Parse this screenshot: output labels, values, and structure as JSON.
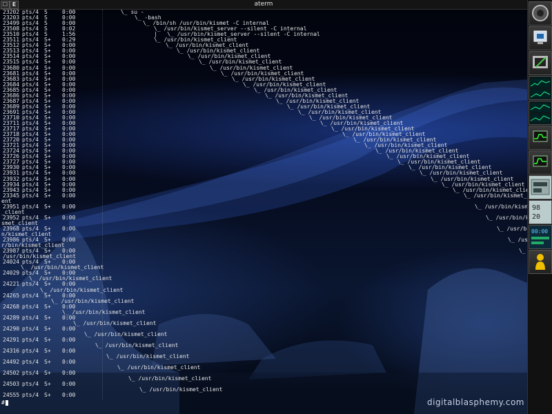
{
  "window": {
    "title": "aterm",
    "left_button": "☐",
    "right_button": "E"
  },
  "process_rows": [
    {
      "pid": "23202",
      "tty": "pts/4",
      "stat": "S",
      "time": "0:00",
      "cmd": "\\_ su -",
      "indent": 175
    },
    {
      "pid": "23203",
      "tty": "pts/4",
      "stat": "S",
      "time": "0:00",
      "cmd": "\\_ -bash",
      "indent": 195
    },
    {
      "pid": "23499",
      "tty": "pts/4",
      "stat": "S",
      "time": "0:00",
      "cmd": "\\_ /bin/sh /usr/bin/kismet -C internal",
      "indent": 207
    },
    {
      "pid": "23508",
      "tty": "pts/4",
      "stat": "S",
      "time": "0:02",
      "cmd": "\\_ /usr/bin/kismet_server --silent -C internal",
      "indent": 223
    },
    {
      "pid": "23510",
      "tty": "pts/4",
      "stat": "S",
      "time": "1:56",
      "cmd": "|   \\_ /usr/bin/kismet_server --silent -C internal",
      "indent": 223
    },
    {
      "pid": "23511",
      "tty": "pts/4",
      "stat": "S+",
      "time": "0:29",
      "cmd": "\\_ /usr/bin/kismet_client",
      "indent": 223
    },
    {
      "pid": "23512",
      "tty": "pts/4",
      "stat": "S+",
      "time": "0:00",
      "cmd": "\\_ /usr/bin/kismet_client",
      "indent": 240
    },
    {
      "pid": "23513",
      "tty": "pts/4",
      "stat": "S+",
      "time": "0:00",
      "cmd": "\\_ /usr/bin/kismet_client",
      "indent": 256
    },
    {
      "pid": "23514",
      "tty": "pts/4",
      "stat": "S+",
      "time": "0:00",
      "cmd": "\\_ /usr/bin/kismet_client",
      "indent": 272
    },
    {
      "pid": "23515",
      "tty": "pts/4",
      "stat": "S+",
      "time": "0:00",
      "cmd": "\\_ /usr/bin/kismet_client",
      "indent": 288
    },
    {
      "pid": "23680",
      "tty": "pts/4",
      "stat": "S+",
      "time": "0:00",
      "cmd": "\\_ /usr/bin/kismet_client",
      "indent": 304
    },
    {
      "pid": "23681",
      "tty": "pts/4",
      "stat": "S+",
      "time": "0:00",
      "cmd": "\\_ /usr/bin/kismet_client",
      "indent": 320
    },
    {
      "pid": "23683",
      "tty": "pts/4",
      "stat": "S+",
      "time": "0:00",
      "cmd": "\\_ /usr/bin/kismet_client",
      "indent": 336
    },
    {
      "pid": "23684",
      "tty": "pts/4",
      "stat": "S+",
      "time": "0:00",
      "cmd": "\\_ /usr/bin/kismet_client",
      "indent": 352
    },
    {
      "pid": "23685",
      "tty": "pts/4",
      "stat": "S+",
      "time": "0:00",
      "cmd": "\\_ /usr/bin/kismet_client",
      "indent": 368
    },
    {
      "pid": "23686",
      "tty": "pts/4",
      "stat": "S+",
      "time": "0:00",
      "cmd": "\\_ /usr/bin/kismet_client",
      "indent": 384
    },
    {
      "pid": "23687",
      "tty": "pts/4",
      "stat": "S+",
      "time": "0:00",
      "cmd": "\\_ /usr/bin/kismet_client",
      "indent": 400
    },
    {
      "pid": "23689",
      "tty": "pts/4",
      "stat": "S+",
      "time": "0:00",
      "cmd": "\\_ /usr/bin/kismet_client",
      "indent": 416
    },
    {
      "pid": "23691",
      "tty": "pts/4",
      "stat": "S+",
      "time": "0:00",
      "cmd": "\\_ /usr/bin/kismet_client",
      "indent": 432
    },
    {
      "pid": "23710",
      "tty": "pts/4",
      "stat": "S+",
      "time": "0:00",
      "cmd": "\\_ /usr/bin/kismet_client",
      "indent": 448
    },
    {
      "pid": "23711",
      "tty": "pts/4",
      "stat": "S+",
      "time": "0:00",
      "cmd": "\\_ /usr/bin/kismet_client",
      "indent": 464
    },
    {
      "pid": "23717",
      "tty": "pts/4",
      "stat": "S+",
      "time": "0:00",
      "cmd": "\\_ /usr/bin/kismet_client",
      "indent": 480
    },
    {
      "pid": "23718",
      "tty": "pts/4",
      "stat": "S+",
      "time": "0:00",
      "cmd": "\\_ /usr/bin/kismet_client",
      "indent": 496
    },
    {
      "pid": "23720",
      "tty": "pts/4",
      "stat": "S+",
      "time": "0:00",
      "cmd": "\\_ /usr/bin/kismet_client",
      "indent": 512
    },
    {
      "pid": "23721",
      "tty": "pts/4",
      "stat": "S+",
      "time": "0:00",
      "cmd": "\\_ /usr/bin/kismet_client",
      "indent": 528
    },
    {
      "pid": "23724",
      "tty": "pts/4",
      "stat": "S+",
      "time": "0:00",
      "cmd": "\\_ /usr/bin/kismet_client",
      "indent": 544
    },
    {
      "pid": "23726",
      "tty": "pts/4",
      "stat": "S+",
      "time": "0:00",
      "cmd": "\\_ /usr/bin/kismet_client",
      "indent": 560
    },
    {
      "pid": "23727",
      "tty": "pts/4",
      "stat": "S+",
      "time": "0:00",
      "cmd": "\\_ /usr/bin/kismet_client",
      "indent": 576
    },
    {
      "pid": "23930",
      "tty": "pts/4",
      "stat": "S+",
      "time": "0:00",
      "cmd": "\\_ /usr/bin/kismet_client",
      "indent": 592
    },
    {
      "pid": "23931",
      "tty": "pts/4",
      "stat": "S+",
      "time": "0:00",
      "cmd": "\\_ /usr/bin/kismet_client",
      "indent": 608
    },
    {
      "pid": "23932",
      "tty": "pts/4",
      "stat": "S+",
      "time": "0:00",
      "cmd": "\\_ /usr/bin/kismet_client",
      "indent": 624
    },
    {
      "pid": "23934",
      "tty": "pts/4",
      "stat": "S+",
      "time": "0:00",
      "cmd": "\\_ /usr/bin/kismet_client",
      "indent": 640
    },
    {
      "pid": "23943",
      "tty": "pts/4",
      "stat": "S+",
      "time": "0:00",
      "cmd": "\\_ /usr/bin/kismet_client",
      "indent": 656
    },
    {
      "pid": "23345",
      "tty": "pts/4",
      "stat": "S+",
      "time": "0:00",
      "cmd": "\\_ /usr/bin/kismet_cli",
      "indent": 672
    }
  ],
  "wrap_rows": [
    {
      "pid": "23951",
      "tty": "pts/4",
      "stat": "S+",
      "time": "0:00",
      "carry": "ent",
      "cmd": "\\_ /usr/bin/kismet_clie",
      "indent": 688
    },
    {
      "pid": "23952",
      "tty": "pts/4",
      "stat": "S+",
      "time": "0:00",
      "carry": "_client",
      "cmd": "\\_ /usr/bin/ki",
      "indent": 704
    },
    {
      "pid": "23968",
      "tty": "pts/4",
      "stat": "S+",
      "time": "0:00",
      "carry": "smet_client",
      "cmd": "\\_ /usr/bi",
      "indent": 720
    },
    {
      "pid": "23986",
      "tty": "pts/4",
      "stat": "S+",
      "time": "0:00",
      "carry": "n/kismet_client",
      "cmd": "\\_ /us",
      "indent": 736
    },
    {
      "pid": "23987",
      "tty": "pts/4",
      "stat": "S+",
      "time": "0:00",
      "carry": "r/bin/kismet_client",
      "cmd": "\\_",
      "indent": 752
    },
    {
      "pid": "24024",
      "tty": "pts/4",
      "stat": "S+",
      "time": "0:00",
      "carry": "/usr/bin/kismet_client",
      "cmd": "",
      "indent": 0
    },
    {
      "pid": "24029",
      "tty": "pts/4",
      "stat": "S+",
      "time": "0:00",
      "carry": "\\_ /usr/bin/kismet_client",
      "cmd": "",
      "indent": 0
    },
    {
      "pid": "24221",
      "tty": "pts/4",
      "stat": "S+",
      "time": "0:00",
      "carry": "\\_ /usr/bin/kismet_client",
      "cmd": "",
      "indent": 0
    },
    {
      "pid": "24265",
      "tty": "pts/4",
      "stat": "S+",
      "time": "0:00",
      "carry": "\\_ /usr/bin/kismet_client",
      "cmd": "",
      "indent": 0
    },
    {
      "pid": "24268",
      "tty": "pts/4",
      "stat": "S+",
      "time": "0:00",
      "carry": "\\_ /usr/bin/kismet_client",
      "cmd": "",
      "indent": 0
    },
    {
      "pid": "24289",
      "tty": "pts/4",
      "stat": "S+",
      "time": "0:00",
      "carry": "\\_ /usr/bin/kismet_client",
      "cmd": "",
      "indent": 0
    },
    {
      "pid": "24290",
      "tty": "pts/4",
      "stat": "S+",
      "time": "0:00",
      "carry": "\\_ /usr/bin/kismet_client",
      "cmd": "",
      "indent": 0
    },
    {
      "pid": "24291",
      "tty": "pts/4",
      "stat": "S+",
      "time": "0:00",
      "carry": "\\_ /usr/bin/kismet_client",
      "cmd": "",
      "indent": 0
    },
    {
      "pid": "24316",
      "tty": "pts/4",
      "stat": "S+",
      "time": "0:00",
      "carry": "\\_ /usr/bin/kismet_client",
      "cmd": "",
      "indent": 0
    },
    {
      "pid": "24492",
      "tty": "pts/4",
      "stat": "S+",
      "time": "0:00",
      "carry": "\\_ /usr/bin/kismet_client",
      "cmd": "",
      "indent": 0
    },
    {
      "pid": "24502",
      "tty": "pts/4",
      "stat": "S+",
      "time": "0:00",
      "carry": "\\_ /usr/bin/kismet_client",
      "cmd": "",
      "indent": 0
    },
    {
      "pid": "24503",
      "tty": "pts/4",
      "stat": "S+",
      "time": "0:00",
      "carry": "\\_ /usr/bin/kismet_client",
      "cmd": "",
      "indent": 0
    },
    {
      "pid": "24555",
      "tty": "pts/4",
      "stat": "S+",
      "time": "0:00",
      "carry": "\\_ /usr/bin/kismet_client",
      "cmd": "",
      "indent": 0
    }
  ],
  "prompt": "#",
  "wallpaper_credit": "digitalblasphemy.com",
  "dock": {
    "tiles": [
      "app-menu-icon",
      "monitor-icon",
      "terminal-icon",
      "network-monitor",
      "network-monitor-2",
      "cpu-graph",
      "cpu-graph-2",
      "lcd-meter",
      "battery-meter",
      "clock",
      "user-icon"
    ],
    "clock_time": "00:00",
    "meter_1": "98",
    "meter_2": "20"
  },
  "colors": {
    "text": "#e6e6e6",
    "titlebar": "#141414",
    "dock": "#111111"
  }
}
